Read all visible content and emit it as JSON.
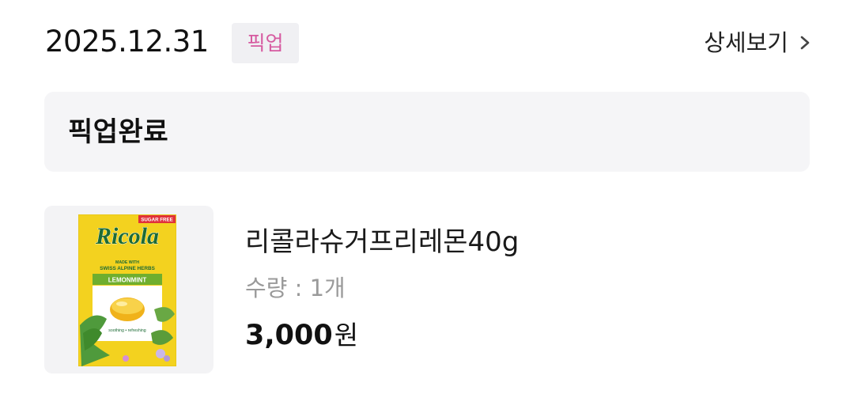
{
  "order": {
    "date": "2025.12.31",
    "type_badge": "픽업",
    "detail_label": "상세보기"
  },
  "status": {
    "text": "픽업완료"
  },
  "product": {
    "name": "리콜라슈거프리레몬40g",
    "quantity": "수량 : 1개",
    "price": "3,000",
    "currency": "원",
    "image_icon": "ricola-candy-box-image",
    "package_texts": {
      "brand": "Ricola",
      "sugar_free": "SUGAR FREE",
      "made_with": "MADE WITH",
      "herbs": "SWISS ALPINE HERBS",
      "flavor": "LEMONMINT",
      "tagline": "soothing • refreshing"
    }
  },
  "colors": {
    "badge_text": "#d65aa0",
    "badge_bg": "#f0f0f3",
    "status_bg": "#f5f5f7",
    "quantity_text": "#9a9a9a",
    "package_yellow": "#f3d21f",
    "package_green": "#1d6b35"
  }
}
